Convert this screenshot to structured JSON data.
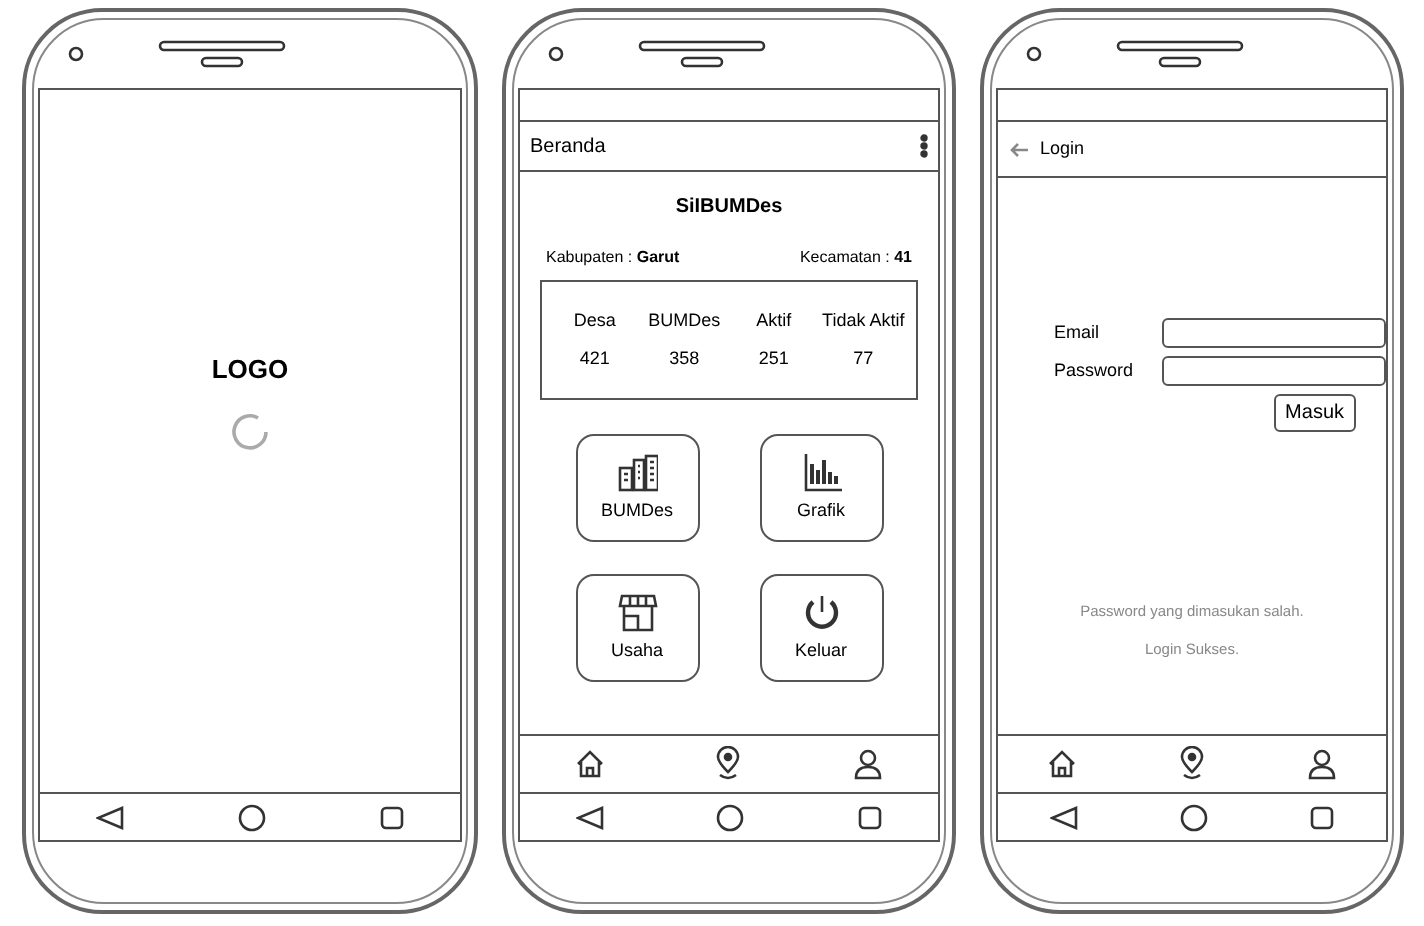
{
  "phones": [
    {
      "kind": "splash",
      "logo": "LOGO"
    },
    {
      "kind": "home",
      "title": "Beranda",
      "app_name": "SiIBUMDes",
      "kabupaten": "Kabupaten : **Garut**",
      "kecamatan": "Kecamatan : **41**",
      "stats": {
        "columns": [
          "Desa",
          "BUMDes",
          "Aktif",
          "Tidak Aktif"
        ],
        "values": [
          "421",
          "358",
          "251",
          "77"
        ]
      },
      "tiles": [
        {
          "kind": "buildings",
          "label": "BUMDes"
        },
        {
          "kind": "chart",
          "label": "Grafik"
        },
        {
          "kind": "store",
          "label": "Usaha"
        },
        {
          "kind": "power",
          "label": "Keluar"
        }
      ]
    },
    {
      "kind": "login",
      "title": "Login",
      "fields": [
        {
          "label": "Email"
        },
        {
          "label": "Password"
        }
      ],
      "button": "Masuk",
      "messages": [
        "Password yang dimasukan salah.",
        "Login Sukses."
      ]
    }
  ]
}
